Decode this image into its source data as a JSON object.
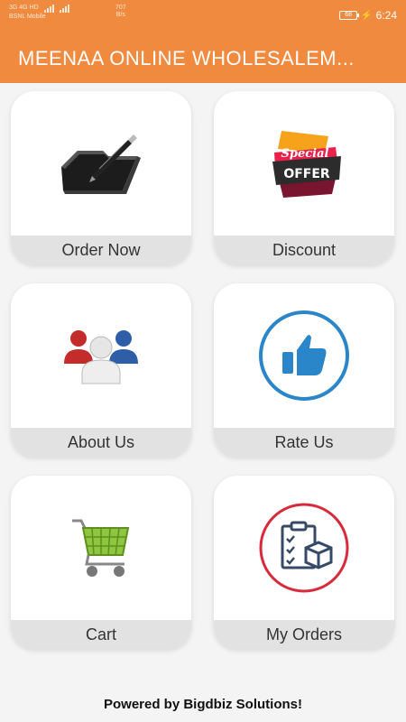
{
  "status_bar": {
    "left_line1": "3G 4G HD",
    "left_line2": "BSNL Mobile",
    "network_speed": "707",
    "speed_unit": "B/s",
    "battery_level": "68",
    "time": "6:24"
  },
  "app_bar": {
    "title": "MEENAA ONLINE WHOLESALEM...",
    "color": "#f08a3e"
  },
  "tiles": [
    {
      "label": "Order Now",
      "icon": "folder-pen-icon"
    },
    {
      "label": "Discount",
      "icon": "special-offer-icon"
    },
    {
      "label": "About Us",
      "icon": "people-group-icon"
    },
    {
      "label": "Rate Us",
      "icon": "thumbs-up-icon"
    },
    {
      "label": "Cart",
      "icon": "shopping-cart-icon"
    },
    {
      "label": "My Orders",
      "icon": "order-checklist-icon"
    }
  ],
  "offer_badge": {
    "line1": "Special",
    "line2": "OFFER"
  },
  "footer": {
    "text": "Powered by Bigdbiz Solutions!"
  }
}
